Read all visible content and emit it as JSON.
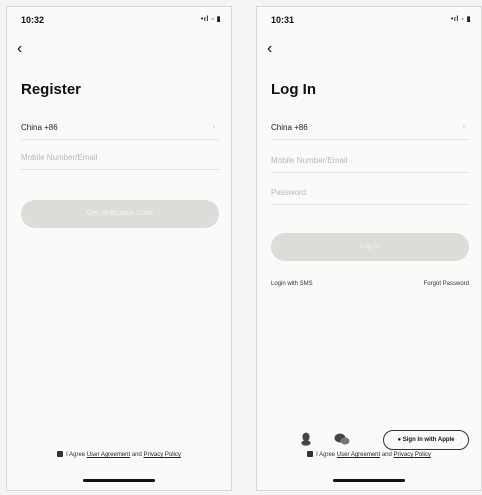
{
  "register": {
    "time": "10:32",
    "status_icons": "•ıl ◦ ▮",
    "back_glyph": "‹",
    "title": "Register",
    "country": "China +86",
    "phone_placeholder": "Mobile Number/Email",
    "primary_button": "Get Verification Code",
    "agree_prefix": "I Agree",
    "user_agreement": "User Agreement",
    "and": "and",
    "privacy_policy": "Privacy Policy"
  },
  "login": {
    "time": "10:31",
    "status_icons": "•ıl ◦ ▮",
    "back_glyph": "‹",
    "title": "Log In",
    "country": "China +86",
    "phone_placeholder": "Mobile Number/Email",
    "password_placeholder": "Password",
    "primary_button": "Log In",
    "login_sms": "Login with SMS",
    "forgot": "Forgot Password",
    "apple_button": "Sign In with Apple",
    "agree_prefix": "I Agree",
    "user_agreement": "User Agreement",
    "and": "and",
    "privacy_policy": "Privacy Policy"
  }
}
